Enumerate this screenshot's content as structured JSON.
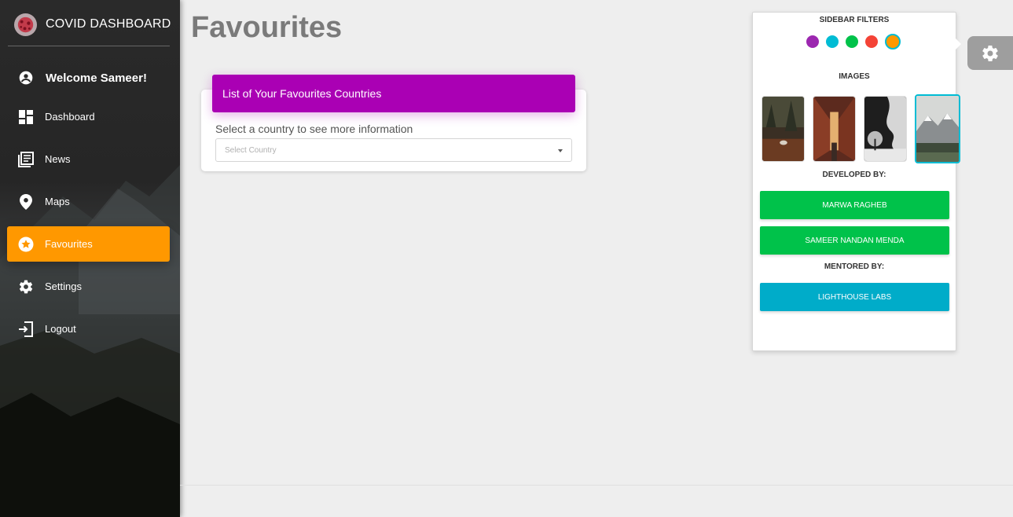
{
  "brand": {
    "title": "COVID DASHBOARD",
    "logo_icon": "virus-icon"
  },
  "user": {
    "greeting": "Welcome Sameer!",
    "icon": "account-circle-icon"
  },
  "nav": {
    "items": [
      {
        "label": "Dashboard",
        "icon": "dashboard-icon",
        "active": false
      },
      {
        "label": "News",
        "icon": "news-icon",
        "active": false
      },
      {
        "label": "Maps",
        "icon": "location-pin-icon",
        "active": false
      },
      {
        "label": "Favourites",
        "icon": "star-icon",
        "active": true
      },
      {
        "label": "Settings",
        "icon": "gear-icon",
        "active": false
      },
      {
        "label": "Logout",
        "icon": "logout-icon",
        "active": false
      }
    ]
  },
  "page": {
    "title": "Favourites"
  },
  "favourites_card": {
    "header": "List of Your Favourites Countries",
    "label": "Select a country to see more information",
    "select_placeholder": "Select Country"
  },
  "panel": {
    "filters_heading": "SIDEBAR FILTERS",
    "filter_colors": [
      "#9c27b0",
      "#00bcd4",
      "#00c24a",
      "#f44336",
      "#ff9800"
    ],
    "selected_filter": "#ff9800",
    "images_heading": "IMAGES",
    "selected_image_index": 3,
    "developed_heading": "DEVELOPED BY:",
    "developers": [
      "MARWA RAGHEB",
      "SAMEER NANDAN MENDA"
    ],
    "mentored_heading": "MENTORED BY:",
    "mentor": "LIGHTHOUSE LABS"
  },
  "colors": {
    "accent": "#ff9800",
    "card_header": "#aa00b4",
    "developer_button": "#00c24a",
    "mentor_button": "#00acc9"
  }
}
